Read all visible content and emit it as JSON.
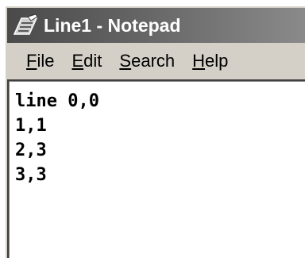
{
  "window": {
    "title": "Line1 - Notepad",
    "app_icon": "notepad-icon"
  },
  "menubar": {
    "items": [
      {
        "accel": "F",
        "rest": "ile"
      },
      {
        "accel": "E",
        "rest": "dit"
      },
      {
        "accel": "S",
        "rest": "earch"
      },
      {
        "accel": "H",
        "rest": "elp"
      }
    ]
  },
  "editor": {
    "content": "line 0,0\n1,1\n2,3\n3,3"
  }
}
